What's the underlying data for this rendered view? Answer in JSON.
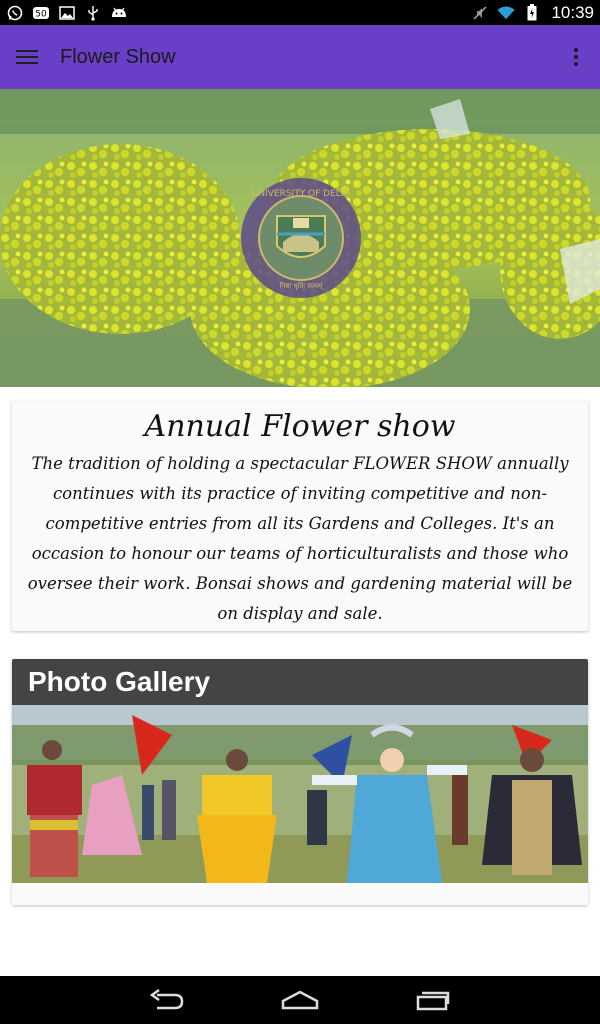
{
  "status_bar": {
    "time": "10:39",
    "left_icons": [
      "whatsapp-icon",
      "sync-badge-icon",
      "image-icon",
      "usb-icon",
      "android-icon"
    ],
    "right_icons": [
      "mute-icon",
      "wifi-icon",
      "battery-icon"
    ]
  },
  "app_bar": {
    "title": "Flower Show",
    "color": "#6a3fc8"
  },
  "hero": {
    "emblem_text_top": "UNIVERSITY OF DELHI",
    "emblem_text_bottom": "निष्ठा धृतिः सत्यम्"
  },
  "about": {
    "title": "Annual Flower show",
    "body": "The tradition of holding a spectacular FLOWER SHOW annually continues with its practice of inviting competitive and non-competitive entries from all its Gardens and Colleges. It's an occasion to honour our teams of  horticulturalists and those who oversee their work. Bonsai shows and gardening material will be on display and sale."
  },
  "gallery": {
    "header": "Photo Gallery",
    "header_color": "#444444"
  },
  "nav_bar": {
    "buttons": [
      "back-icon",
      "home-icon",
      "recents-icon"
    ]
  }
}
